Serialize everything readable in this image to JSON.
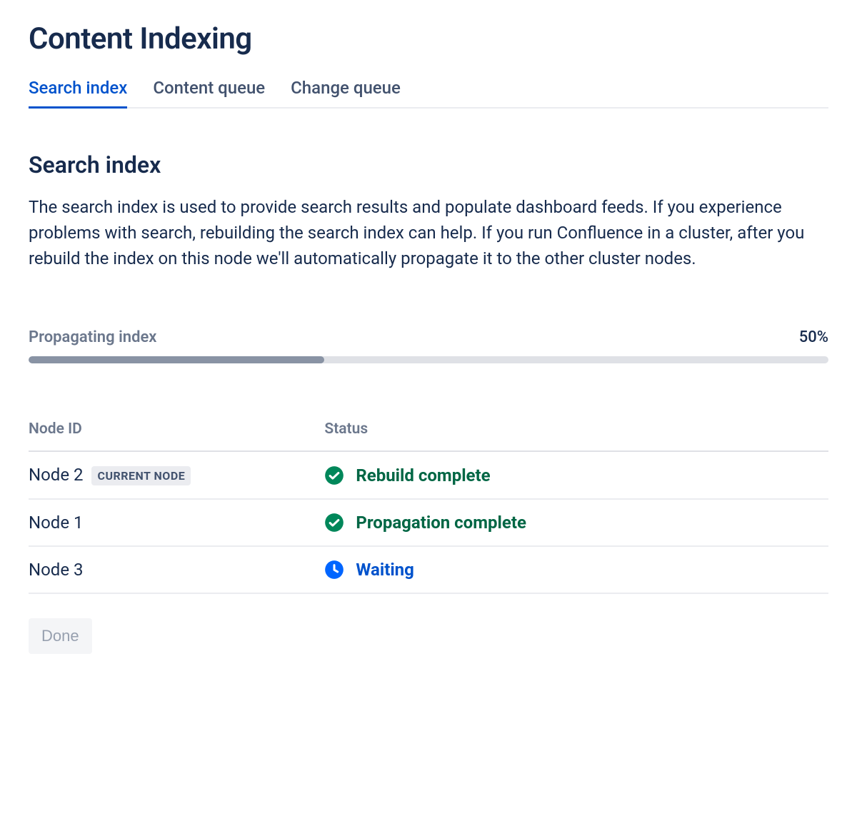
{
  "page": {
    "title": "Content Indexing"
  },
  "tabs": [
    {
      "label": "Search index",
      "active": true
    },
    {
      "label": "Content queue",
      "active": false
    },
    {
      "label": "Change queue",
      "active": false
    }
  ],
  "section": {
    "title": "Search index",
    "description": "The search index is used to provide search results and populate dashboard feeds. If you experience problems with search, rebuilding the search index can help. If you run Confluence in a cluster, after you rebuild the index on this node we'll automatically propagate it to the other cluster nodes."
  },
  "progress": {
    "label": "Propagating index",
    "percent_label": "50%",
    "percent_value": 37
  },
  "table": {
    "headers": {
      "node": "Node ID",
      "status": "Status"
    },
    "rows": [
      {
        "node": "Node 2",
        "badge": "CURRENT NODE",
        "status_text": "Rebuild complete",
        "status_kind": "success",
        "icon": "check-circle-icon"
      },
      {
        "node": "Node 1",
        "badge": null,
        "status_text": "Propagation complete",
        "status_kind": "success",
        "icon": "check-circle-icon"
      },
      {
        "node": "Node 3",
        "badge": null,
        "status_text": "Waiting",
        "status_kind": "waiting",
        "icon": "clock-icon"
      }
    ]
  },
  "actions": {
    "done": "Done"
  },
  "colors": {
    "accent": "#0052cc",
    "success": "#006644",
    "success_icon": "#00875a",
    "waiting_icon": "#0065ff"
  }
}
